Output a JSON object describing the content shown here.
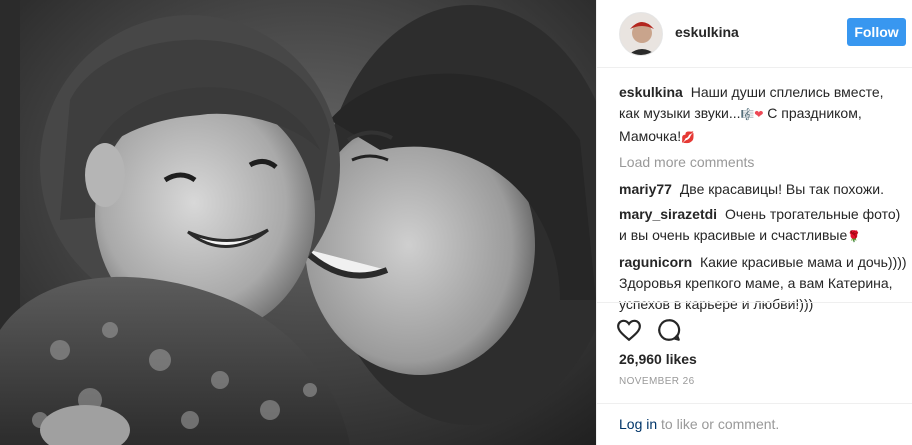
{
  "post": {
    "author": "eskulkina",
    "follow_label": "Follow",
    "caption": {
      "user": "eskulkina",
      "text": "Наши души сплелись вместе, как музыки звуки...",
      "emoji_notes": "🎼",
      "emoji_heart": "❤",
      "text2": " С праздником, Мамочка!",
      "emoji_kiss": "💋"
    },
    "load_more": "Load more comments",
    "comments": [
      {
        "user": "mariy77",
        "text": "Две красавицы! Вы так похожи."
      },
      {
        "user": "mary_sirazetdi",
        "text": "Очень трогательные фото) и вы очень красивые и счастливые",
        "emoji": "🌹"
      },
      {
        "user": "ragunicorn",
        "text": "Какие красивые мама и дочь)))) Здоровья крепкого маме, а вам Катерина, успехов в карьере и любви!)))"
      }
    ],
    "likes": "26,960 likes",
    "date": "NOVEMBER 26",
    "login": {
      "link": "Log in",
      "rest": " to like or comment."
    }
  },
  "icons": {
    "like": "heart-icon",
    "comment": "comment-bubble-icon"
  },
  "colors": {
    "follow_button": "#3897f0",
    "link": "#003569",
    "muted": "#999999"
  }
}
